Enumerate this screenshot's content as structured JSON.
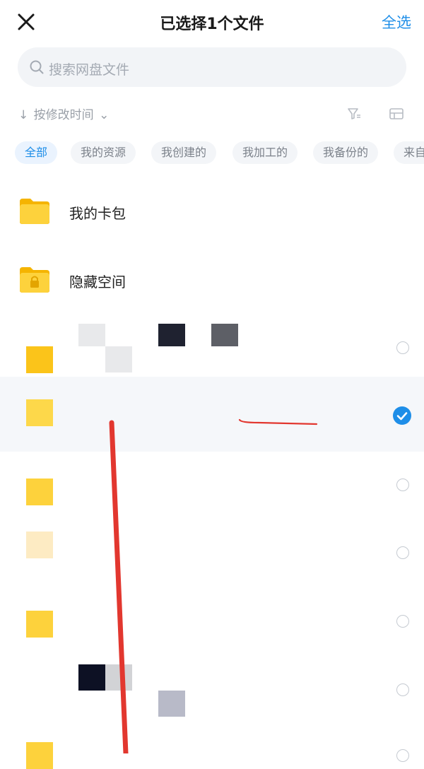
{
  "header": {
    "title": "已选择1个文件",
    "select_all": "全选"
  },
  "search": {
    "placeholder": "搜索网盘文件"
  },
  "sort": {
    "arrow": "↓",
    "label": "按修改时间",
    "chevron": "⌄"
  },
  "filters": [
    {
      "label": "全部",
      "active": true
    },
    {
      "label": "我的资源",
      "active": false
    },
    {
      "label": "我创建的",
      "active": false
    },
    {
      "label": "我加工的",
      "active": false
    },
    {
      "label": "我备份的",
      "active": false
    },
    {
      "label": "来自",
      "active": false
    }
  ],
  "folders": [
    {
      "name": "我的卡包",
      "icon": "folder-icon"
    },
    {
      "name": "隐藏空间",
      "icon": "locked-folder-icon"
    }
  ],
  "files": [
    {
      "selected": false
    },
    {
      "selected": true
    },
    {
      "selected": false
    },
    {
      "selected": false
    },
    {
      "selected": false
    },
    {
      "selected": false
    },
    {
      "selected": false
    }
  ],
  "colors": {
    "accent": "#1e8ee8",
    "folder": "#fdd23c",
    "annotation_red": "#e2372f"
  }
}
